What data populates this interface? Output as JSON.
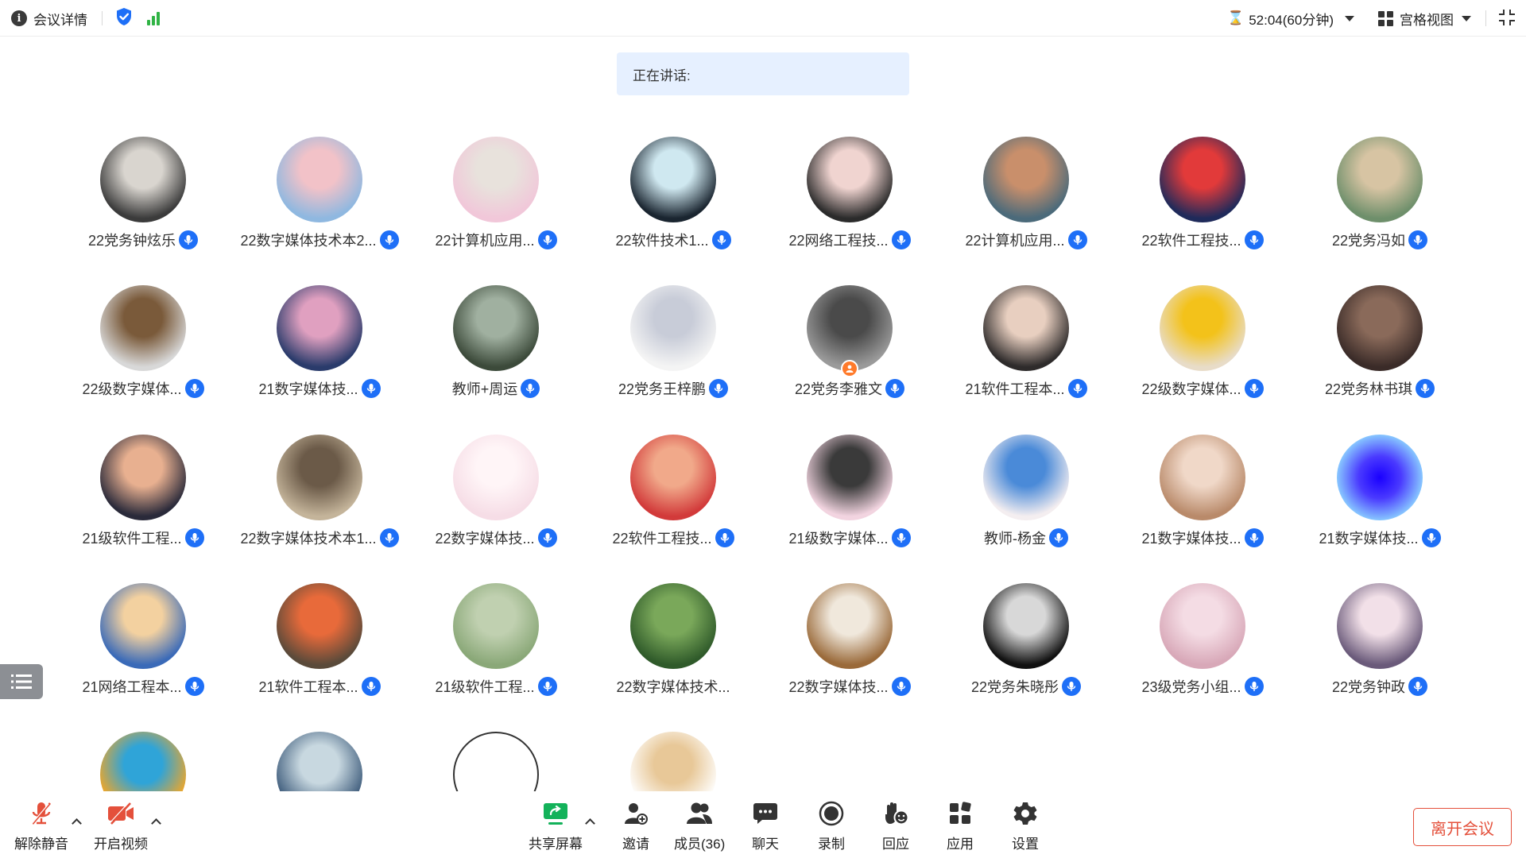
{
  "topbar": {
    "meeting_info_label": "会议详情",
    "timer_text": "52:04(60分钟)",
    "view_label": "宫格视图"
  },
  "speaking_label": "正在讲话:",
  "participants": [
    {
      "name": "22党务钟炫乐"
    },
    {
      "name": "22数字媒体技术本2..."
    },
    {
      "name": "22计算机应用..."
    },
    {
      "name": "22软件技术1..."
    },
    {
      "name": "22网络工程技..."
    },
    {
      "name": "22计算机应用..."
    },
    {
      "name": "22软件工程技..."
    },
    {
      "name": "22党务冯如"
    },
    {
      "name": "22级数字媒体..."
    },
    {
      "name": "21数字媒体技..."
    },
    {
      "name": "教师+周运"
    },
    {
      "name": "22党务王梓鹏"
    },
    {
      "name": "22党务李雅文"
    },
    {
      "name": "21软件工程本..."
    },
    {
      "name": "22级数字媒体..."
    },
    {
      "name": "22党务林书琪"
    },
    {
      "name": "21级软件工程..."
    },
    {
      "name": "22数字媒体技术本1..."
    },
    {
      "name": "22数字媒体技..."
    },
    {
      "name": "22软件工程技..."
    },
    {
      "name": "21级数字媒体..."
    },
    {
      "name": "教师-杨金"
    },
    {
      "name": "21数字媒体技..."
    },
    {
      "name": "21数字媒体技..."
    },
    {
      "name": "21网络工程本..."
    },
    {
      "name": "21软件工程本..."
    },
    {
      "name": "21级软件工程..."
    },
    {
      "name": "22数字媒体技术..."
    },
    {
      "name": "22数字媒体技..."
    },
    {
      "name": "22党务朱晓彤"
    },
    {
      "name": "23级党务小组..."
    },
    {
      "name": "22党务钟政"
    },
    {
      "name": ""
    },
    {
      "name": ""
    },
    {
      "name": ""
    },
    {
      "name": ""
    }
  ],
  "toolbar": {
    "unmute_label": "解除静音",
    "start_video_label": "开启视频",
    "share_screen_label": "共享屏幕",
    "invite_label": "邀请",
    "members_label": "成员(36)",
    "chat_label": "聊天",
    "record_label": "录制",
    "reaction_label": "回应",
    "apps_label": "应用",
    "settings_label": "设置",
    "leave_label": "离开会议"
  },
  "colors": {
    "accent_blue": "#1e6ff7",
    "signal_green": "#2fb344",
    "leave_red": "#e4503b",
    "speaking_bg": "#e6f0ff",
    "muted_red": "#e4503b"
  }
}
